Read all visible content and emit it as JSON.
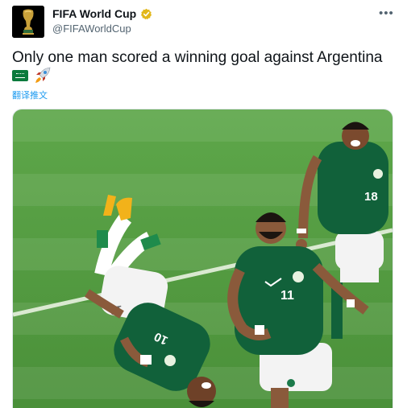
{
  "header": {
    "display_name": "FIFA World Cup",
    "handle": "@FIFAWorldCup",
    "verified_icon": "gold-verified-badge",
    "more_icon": "ellipsis-icon"
  },
  "tweet": {
    "text": "Only one man scored a winning goal against Argentina",
    "emojis": [
      "saudi-arabia-flag",
      "rocket"
    ],
    "translate_label": "翻译推文"
  },
  "media": {
    "jersey_numbers": [
      "10",
      "11",
      "18"
    ],
    "colors": {
      "pitch": "#4f9a3f",
      "jersey": "#11613a",
      "shorts": "#f3f3f3",
      "accent": "#1d9bf0"
    }
  }
}
